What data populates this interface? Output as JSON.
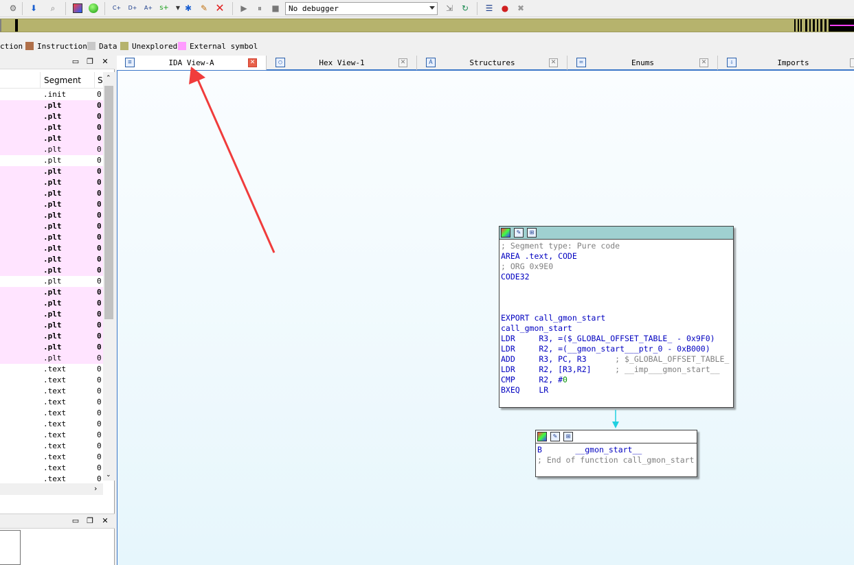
{
  "toolbar": {
    "debugger_select": "No debugger",
    "icons": [
      "gear-icon",
      "jump-arrow-icon",
      "search-icon",
      "color-icon",
      "green-circle-icon",
      "create-code-icon",
      "create-data-icon",
      "create-string-icon",
      "create-struct-icon",
      "create-function-icon",
      "edit-icon",
      "delete-icon",
      "run-icon",
      "pause-icon",
      "stop-icon",
      "attach-icon",
      "step-icon",
      "breakpoint-list-icon",
      "add-breakpoint-icon",
      "remove-breakpoint-icon"
    ]
  },
  "legend": {
    "items": [
      {
        "label": "ction",
        "color": ""
      },
      {
        "label": "Instruction",
        "color": "#b0704a"
      },
      {
        "label": "Data",
        "color": "#c8c8c8"
      },
      {
        "label": "Unexplored",
        "color": "#b6b36d"
      },
      {
        "label": "External symbol",
        "color": "#ff9cff"
      }
    ]
  },
  "left_panel": {
    "columns": [
      "Segment",
      "S"
    ],
    "rows": [
      {
        "segment": ".init",
        "v": "0",
        "type": "normal",
        "bold": false
      },
      {
        "segment": ".plt",
        "v": "0",
        "type": "ext",
        "bold": true
      },
      {
        "segment": ".plt",
        "v": "0",
        "type": "ext",
        "bold": true
      },
      {
        "segment": ".plt",
        "v": "0",
        "type": "ext",
        "bold": true
      },
      {
        "segment": ".plt",
        "v": "0",
        "type": "ext",
        "bold": true
      },
      {
        "segment": ".plt",
        "v": "0",
        "type": "ext",
        "bold": false
      },
      {
        "segment": ".plt",
        "v": "0",
        "type": "normal",
        "bold": false
      },
      {
        "segment": ".plt",
        "v": "0",
        "type": "ext",
        "bold": true
      },
      {
        "segment": ".plt",
        "v": "0",
        "type": "ext",
        "bold": true
      },
      {
        "segment": ".plt",
        "v": "0",
        "type": "ext",
        "bold": true
      },
      {
        "segment": ".plt",
        "v": "0",
        "type": "ext",
        "bold": true
      },
      {
        "segment": ".plt",
        "v": "0",
        "type": "ext",
        "bold": true
      },
      {
        "segment": ".plt",
        "v": "0",
        "type": "ext",
        "bold": true
      },
      {
        "segment": ".plt",
        "v": "0",
        "type": "ext",
        "bold": true
      },
      {
        "segment": ".plt",
        "v": "0",
        "type": "ext",
        "bold": true
      },
      {
        "segment": ".plt",
        "v": "0",
        "type": "ext",
        "bold": true
      },
      {
        "segment": ".plt",
        "v": "0",
        "type": "ext",
        "bold": true
      },
      {
        "segment": ".plt",
        "v": "0",
        "type": "normal",
        "bold": false
      },
      {
        "segment": ".plt",
        "v": "0",
        "type": "ext",
        "bold": true
      },
      {
        "segment": ".plt",
        "v": "0",
        "type": "ext",
        "bold": true
      },
      {
        "segment": ".plt",
        "v": "0",
        "type": "ext",
        "bold": true
      },
      {
        "segment": ".plt",
        "v": "0",
        "type": "ext",
        "bold": true
      },
      {
        "segment": ".plt",
        "v": "0",
        "type": "ext",
        "bold": true
      },
      {
        "segment": ".plt",
        "v": "0",
        "type": "ext",
        "bold": true
      },
      {
        "segment": ".plt",
        "v": "0",
        "type": "ext",
        "bold": false
      },
      {
        "segment": ".text",
        "v": "0",
        "type": "normal",
        "bold": false
      },
      {
        "segment": ".text",
        "v": "0",
        "type": "normal",
        "bold": false
      },
      {
        "segment": ".text",
        "v": "0",
        "type": "normal",
        "bold": false
      },
      {
        "segment": ".text",
        "v": "0",
        "type": "normal",
        "bold": false
      },
      {
        "segment": ".text",
        "v": "0",
        "type": "normal",
        "bold": false
      },
      {
        "segment": ".text",
        "v": "0",
        "type": "normal",
        "bold": false
      },
      {
        "segment": ".text",
        "v": "0",
        "type": "normal",
        "bold": false
      },
      {
        "segment": ".text",
        "v": "0",
        "type": "normal",
        "bold": false
      },
      {
        "segment": ".text",
        "v": "0",
        "type": "normal",
        "bold": false
      },
      {
        "segment": ".text",
        "v": "0",
        "type": "normal",
        "bold": false
      },
      {
        "segment": ".text",
        "v": "0",
        "type": "normal",
        "bold": false
      }
    ]
  },
  "tabs": [
    {
      "label": "IDA View-A",
      "icon": "ida-view-icon",
      "active": true
    },
    {
      "label": "Hex View-1",
      "icon": "hex-view-icon",
      "active": false
    },
    {
      "label": "Structures",
      "icon": "structures-icon",
      "active": false
    },
    {
      "label": "Enums",
      "icon": "enums-icon",
      "active": false
    },
    {
      "label": "Imports",
      "icon": "imports-icon",
      "active": false
    }
  ],
  "graph": {
    "node1": {
      "lines": [
        {
          "parts": [
            {
              "t": "; Segment type: Pure code",
              "c": "cmt"
            }
          ]
        },
        {
          "parts": [
            {
              "t": "AREA .text, CODE",
              "c": "kw"
            }
          ]
        },
        {
          "parts": [
            {
              "t": "; ORG 0x9E0",
              "c": "cmt"
            }
          ]
        },
        {
          "parts": [
            {
              "t": "CODE32",
              "c": "kw"
            }
          ]
        },
        {
          "parts": [
            {
              "t": "",
              "c": ""
            }
          ]
        },
        {
          "parts": [
            {
              "t": "",
              "c": ""
            }
          ]
        },
        {
          "parts": [
            {
              "t": "",
              "c": ""
            }
          ]
        },
        {
          "parts": [
            {
              "t": "EXPORT call_gmon_start",
              "c": "kw"
            }
          ]
        },
        {
          "parts": [
            {
              "t": "call_gmon_start",
              "c": "kw"
            }
          ]
        },
        {
          "parts": [
            {
              "t": "LDR     R3, =($_GLOBAL_OFFSET_TABLE_ - 0x9F0)",
              "c": "kw"
            }
          ]
        },
        {
          "parts": [
            {
              "t": "LDR     R2, =(__gmon_start___ptr_0 - 0xB000)",
              "c": "kw"
            }
          ]
        },
        {
          "parts": [
            {
              "t": "ADD     R3, PC, R3",
              "c": "kw"
            },
            {
              "t": "      ; $_GLOBAL_OFFSET_TABLE_",
              "c": "cmt"
            }
          ]
        },
        {
          "parts": [
            {
              "t": "LDR     R2, [R3,R2]",
              "c": "kw"
            },
            {
              "t": "     ; __imp___gmon_start__",
              "c": "cmt"
            }
          ]
        },
        {
          "parts": [
            {
              "t": "CMP     R2, #",
              "c": "kw"
            },
            {
              "t": "0",
              "c": "num"
            }
          ]
        },
        {
          "parts": [
            {
              "t": "BXEQ    LR",
              "c": "kw"
            }
          ]
        }
      ]
    },
    "node2": {
      "lines": [
        {
          "parts": [
            {
              "t": "B       __gmon_start__",
              "c": "kw"
            }
          ]
        },
        {
          "parts": [
            {
              "t": "; End of function call_gmon_start",
              "c": "cmt"
            }
          ]
        }
      ]
    }
  }
}
